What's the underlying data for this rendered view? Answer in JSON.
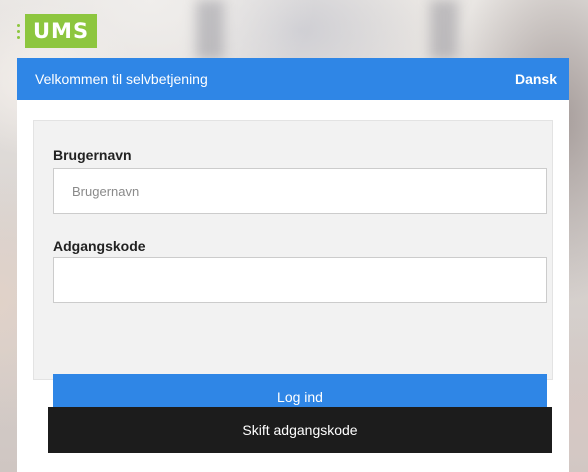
{
  "logo": {
    "text": "UMS",
    "color": "#8dc63f"
  },
  "header": {
    "title": "Velkommen til selvbetjening",
    "language": "Dansk",
    "color": "#2f86e6"
  },
  "form": {
    "username_label": "Brugernavn",
    "username_placeholder": "Brugernavn",
    "username_value": "",
    "password_label": "Adgangskode",
    "password_value": "",
    "login_label": "Log ind"
  },
  "change_password_label": "Skift adgangskode"
}
